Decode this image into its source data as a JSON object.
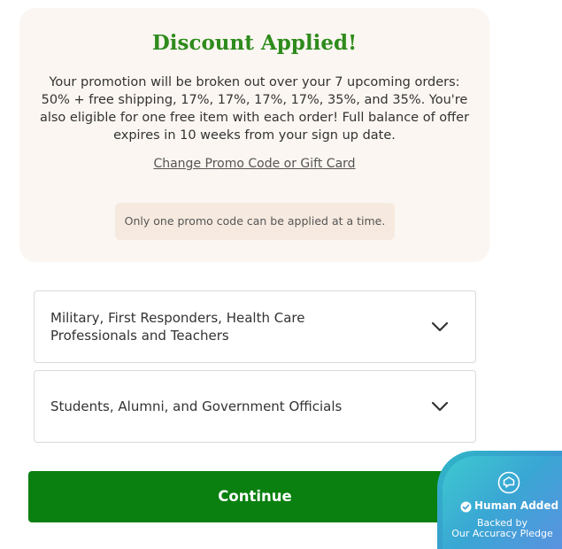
{
  "promo": {
    "title": "Discount Applied!",
    "description": "Your promotion will be broken out over your 7 upcoming orders: 50% + free shipping, 17%, 17%, 17%, 17%, 35%, and 35%. You're also eligible for one free item with each order! Full balance of offer expires in 10 weeks from your sign up date.",
    "change_link": "Change Promo Code or Gift Card",
    "note": "Only one promo code can be applied at a time."
  },
  "discounts": [
    {
      "label": "Military, First Responders, Health Care Professionals and Teachers",
      "icon": "chevron-down-icon"
    },
    {
      "label": "Students, Alumni, and Government Officials",
      "icon": "chevron-down-icon"
    }
  ],
  "continue_label": "Continue",
  "badge": {
    "title": "Human Added",
    "subtitle_line1": "Backed by",
    "subtitle_line2": "Our Accuracy Pledge"
  },
  "colors": {
    "accent_green": "#0a8010",
    "title_green": "#2e8b1c",
    "card_bg": "#fbf6f1"
  }
}
